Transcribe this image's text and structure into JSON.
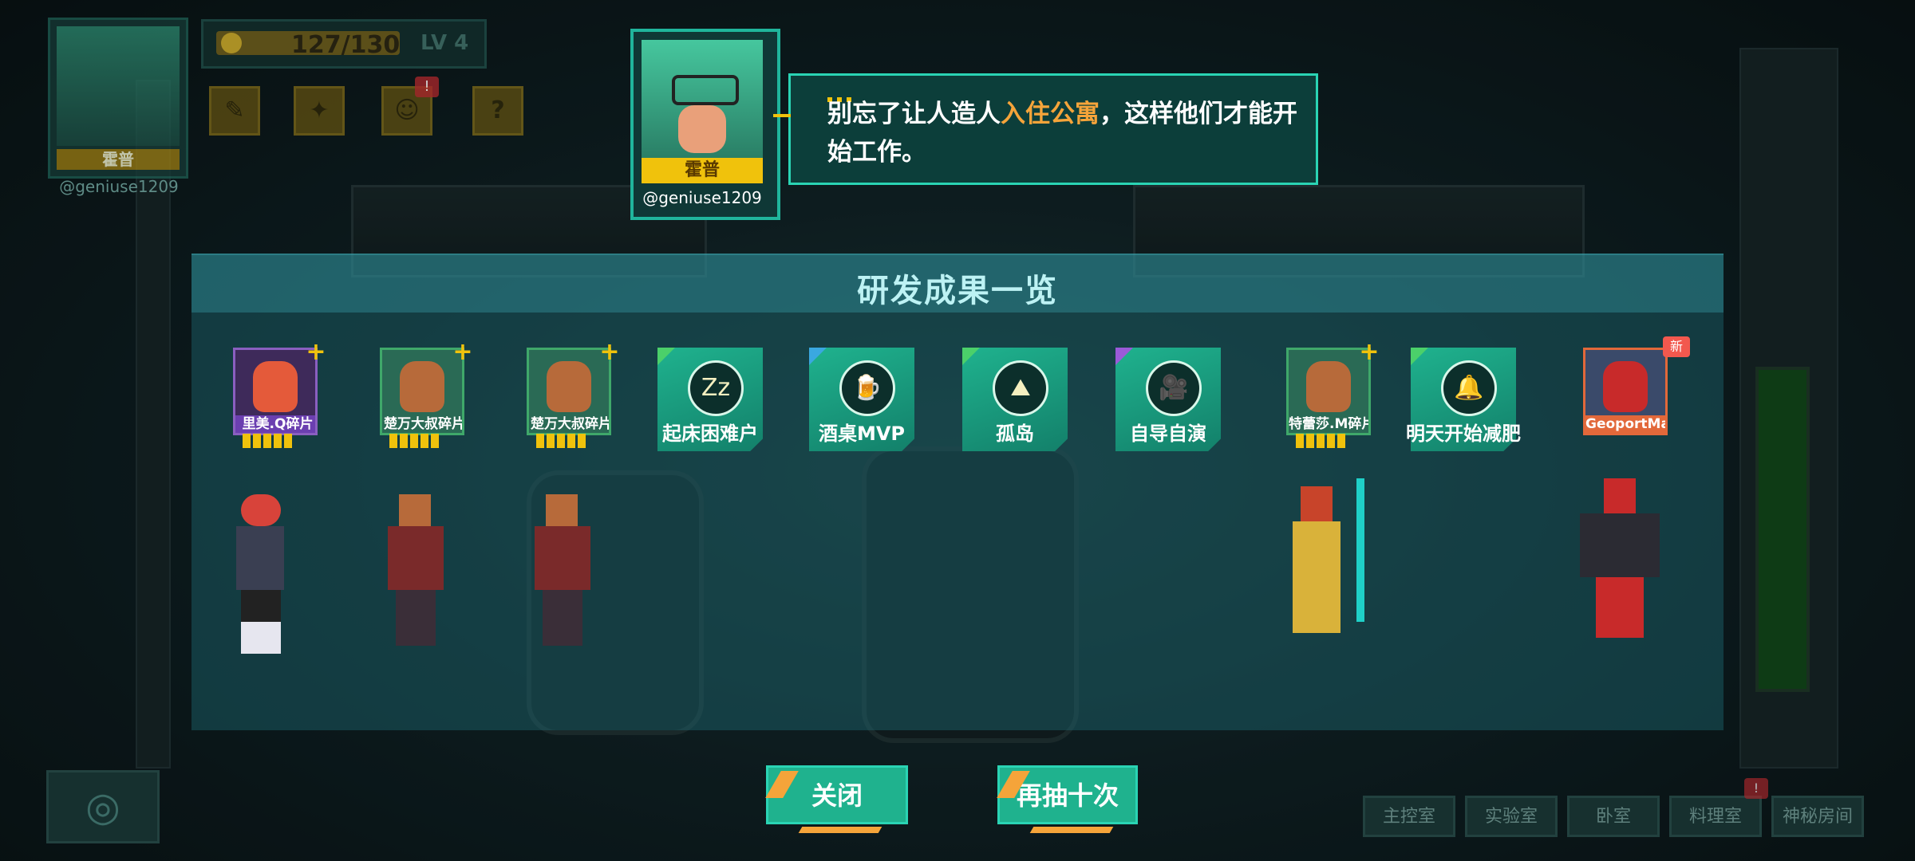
{
  "player": {
    "name": "霍普",
    "handle": "@geniuse1209",
    "energy": "127/130",
    "level_label": "LV",
    "level": "4",
    "notification_count": "!"
  },
  "dialog": {
    "speaker_name": "霍普",
    "speaker_handle": "@geniuse1209",
    "text_before": "别忘了让人造人",
    "text_highlight": "入住公寓",
    "text_after": "，这样他们才能开始工作。"
  },
  "results": {
    "title": "研发成果一览",
    "cards": [
      {
        "type": "character",
        "label": "里美.Q碎片",
        "rarity": "purple",
        "pips": 5,
        "plus": "+"
      },
      {
        "type": "character",
        "label": "楚万大叔碎片",
        "rarity": "green",
        "pips": 5,
        "plus": "+"
      },
      {
        "type": "character",
        "label": "楚万大叔碎片",
        "rarity": "green",
        "pips": 5,
        "plus": "+"
      },
      {
        "type": "item",
        "label": "起床困难户",
        "icon": "sleep-pillow-icon",
        "glyph": "Zz",
        "corner": "#4bd06a"
      },
      {
        "type": "item",
        "label": "酒桌MVP",
        "icon": "beer-mug-icon",
        "glyph": "🍺",
        "corner": "#3aa8e0"
      },
      {
        "type": "item",
        "label": "孤岛",
        "icon": "island-icon",
        "glyph": "⛰",
        "corner": "#4bd06a"
      },
      {
        "type": "item",
        "label": "自导自演",
        "icon": "movie-camera-icon",
        "glyph": "🎥",
        "corner": "#9a5ad8"
      },
      {
        "type": "character",
        "label": "特蕾莎.M碎片",
        "rarity": "green",
        "pips": 5,
        "plus": "+"
      },
      {
        "type": "item",
        "label": "明天开始减肥",
        "icon": "food-cloche-icon",
        "glyph": "🔔",
        "corner": "#4bd06a"
      },
      {
        "type": "character",
        "label": "GeoportMan",
        "rarity": "orange",
        "pips": 0,
        "new_badge": "新"
      }
    ]
  },
  "buttons": {
    "close": "关闭",
    "draw_ten_again": "再抽十次"
  },
  "rooms": {
    "items": [
      "主控室",
      "实验室",
      "卧室",
      "料理室",
      "神秘房间"
    ],
    "badge": "!"
  },
  "colors": {
    "accent_teal": "#1fb28e",
    "highlight_orange": "#f5a43a",
    "gold": "#f0c20c"
  }
}
